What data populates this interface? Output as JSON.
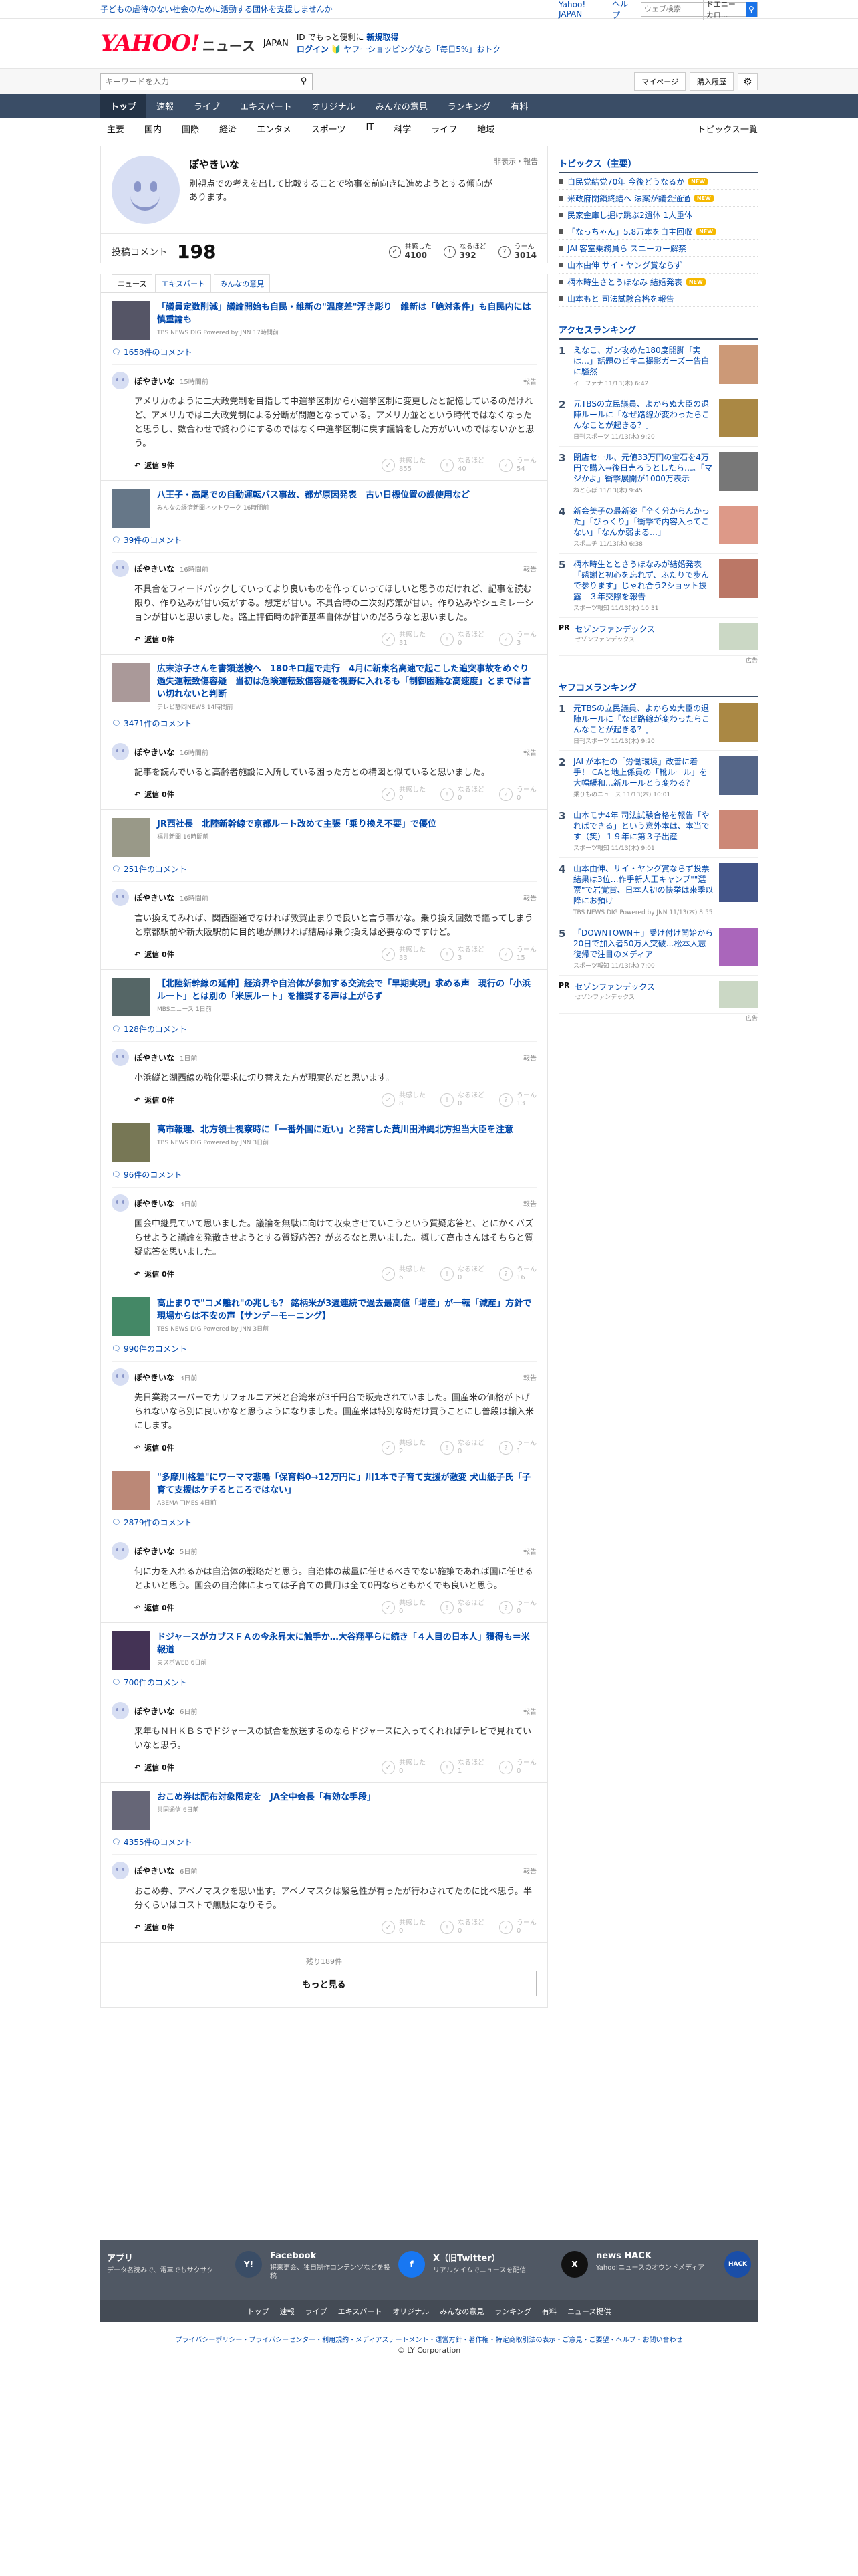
{
  "topbar": {
    "promo": "子どもの虐待のない社会のために活動する団体を支援しませんか",
    "yjapan": "Yahoo! JAPAN",
    "help": "ヘルプ",
    "search_placeholder": "ウェブ検索",
    "search_tag": "ドエニーカロ..."
  },
  "header": {
    "logo": "YAHOO!",
    "logo_sub": "JAPAN",
    "news": "ニュース",
    "promo_a": "ID でもっと便利に",
    "promo_b": "新規取得",
    "promo_login": "ログイン",
    "promo_c": "🔰 ヤフーショッピングなら「毎日5%」おトク"
  },
  "search": {
    "placeholder": "キーワードを入力",
    "mypage": "マイページ",
    "history": "購入履歴"
  },
  "nav": [
    "トップ",
    "速報",
    "ライブ",
    "エキスパート",
    "オリジナル",
    "みんなの意見",
    "ランキング",
    "有料"
  ],
  "subnav": [
    "主要",
    "国内",
    "国際",
    "経済",
    "エンタメ",
    "スポーツ",
    "IT",
    "科学",
    "ライフ",
    "地域"
  ],
  "subnav_topics": "トピックス一覧",
  "profile": {
    "name": "ぽやきいな",
    "bio": "別視点での考えを出して比較することで物事を前向きに進めようとする傾向があります。",
    "report": "非表示・報告",
    "comment_label": "投稿コメント",
    "comment_count": "198",
    "kyokan_label": "共感した",
    "kyokan": "4100",
    "naruhodo_label": "なるほど",
    "naruhodo": "392",
    "un_label": "うーん",
    "un": "3014"
  },
  "tabs": [
    "ニュース",
    "エキスパート",
    "みんなの意見"
  ],
  "entries": [
    {
      "title": "「議員定数削減」議論開始も自民・維新の\"温度差\"浮き彫り　維新は「絶対条件」も自民内には慎重論も",
      "src": "TBS NEWS DIG Powered by JNN 17時間前",
      "count": "1658件のコメント",
      "time": "15時間前",
      "text": "アメリカのように二大政党制を目指して中選挙区制から小選挙区制に変更したと記憶しているのだけれど、アメリカでは二大政党制による分断が問題となっている。アメリカ並とという時代ではなくなったと思うし、数合わせで終わりにするのではなく中選挙区制に戻す議論をした方がいいのではないかと思う。",
      "reply": "返信 9件",
      "k": "855",
      "n": "40",
      "u": "54",
      "thumb": "#556"
    },
    {
      "title": "八王子・高尾での自動運転バス事故、都が原因発表　古い日標位置の誤使用など",
      "src": "みんなの経済新聞ネットワーク 16時間前",
      "count": "39件のコメント",
      "time": "16時間前",
      "text": "不具合をフィードバックしていってより良いものを作っていってほしいと思うのだけれど、記事を読む限り、作り込みが甘い気がする。想定が甘い。不具合時の二次対応策が甘い。作り込みやシュミレーションが甘いと思いました。路上評価時の評価基準自体が甘いのだろうなと思いました。",
      "reply": "返信 0件",
      "k": "31",
      "n": "0",
      "u": "3",
      "thumb": "#678"
    },
    {
      "title": "広末涼子さんを書類送検へ　180キロ超で走行　4月に新東名高速で起こした追突事故をめぐり過失運転致傷容疑　当初は危険運転致傷容疑を視野に入れるも「制御困難な高速度」とまでは言い切れないと判断",
      "src": "テレビ静岡NEWS 14時間前",
      "count": "3471件のコメント",
      "time": "16時間前",
      "text": "記事を読んでいると高齢者施設に入所している困った方との構図と似ていると思いました。",
      "reply": "返信 0件",
      "k": "0",
      "n": "0",
      "u": "0",
      "thumb": "#a99"
    },
    {
      "title": "JR西社長　北陸新幹線で京都ルート改めて主張「乗り換え不要」で優位",
      "src": "福井新聞 16時間前",
      "count": "251件のコメント",
      "time": "16時間前",
      "text": "言い換えてみれば、関西圏通でなければ敦賀止まりで良いと言う事かな。乗り換え回数で謳ってしまうと京都駅前や新大阪駅前に目的地が無ければ結局は乗り換えは必要なのですけど。",
      "reply": "返信 0件",
      "k": "33",
      "n": "3",
      "u": "15",
      "thumb": "#998"
    },
    {
      "title": "【北陸新幹線の延伸】経済界や自治体が参加する交流会で「早期実現」求める声　現行の「小浜ルート」とは別の「米原ルート」を推奨する声は上がらず",
      "src": "MBSニュース 1日前",
      "count": "128件のコメント",
      "time": "1日前",
      "text": "小浜縦と湖西線の強化要求に切り替えた方が現実的だと思います。",
      "reply": "返信 0件",
      "k": "8",
      "n": "0",
      "u": "13",
      "thumb": "#566"
    },
    {
      "title": "高市報理、北方領土視察時に「一番外国に近い」と発言した黄川田沖縄北方担当大臣を注意",
      "src": "TBS NEWS DIG Powered by JNN 3日前",
      "count": "96件のコメント",
      "time": "3日前",
      "text": "国会中継見ていて思いました。議論を無駄に向けて収束させていこうという質疑応答と、とにかくバズらせようと議論を発散させようとする質疑応答？があるなと思いました。概して高市さんはそちらと質疑応答を思いました。",
      "reply": "返信 0件",
      "k": "6",
      "n": "0",
      "u": "16",
      "thumb": "#775"
    },
    {
      "title": "高止まりで\"コメ離れ\"の兆しも？ 銘柄米が3週連続で過去最高値「増産」が一転「減産」方針で現場からは不安の声【サンデーモーニング】",
      "src": "TBS NEWS DIG Powered by JNN 3日前",
      "count": "990件のコメント",
      "time": "3日前",
      "text": "先日業務スーパーでカリフォルニア米と台湾米が3千円台で販売されていました。国産米の価格が下げられないなら別に良いかなと思うようになりました。国産米は特別な時だけ買うことにし普段は輸入米にします。",
      "reply": "返信 0件",
      "k": "2",
      "n": "0",
      "u": "1",
      "thumb": "#486"
    },
    {
      "title": "\"多摩川格差\"にワーママ悲鳴「保育料0→12万円に」川1本で子育て支援が激変 犬山紙子氏「子育て支援はケチるところではない」",
      "src": "ABEMA TIMES 4日前",
      "count": "2879件のコメント",
      "time": "5日前",
      "text": "何に力を入れるかは自治体の戦略だと思う。自治体の裁量に任せるべきでない施策であれば国に任せるとよいと思う。国会の自治体によっては子育ての費用は全て0円ならともかくでも良いと思う。",
      "reply": "返信 0件",
      "k": "0",
      "n": "0",
      "u": "0",
      "thumb": "#b87"
    },
    {
      "title": "ドジャースがカブスＦＡの今永昇太に触手か…大谷翔平らに続き「４人目の日本人」獲得も＝米報道",
      "src": "東スポWEB 6日前",
      "count": "700件のコメント",
      "time": "6日前",
      "text": "来年もＮＨＫＢＳでドジャースの試合を放送するのならドジャースに入ってくれればテレビで見れていいなと思う。",
      "reply": "返信 0件",
      "k": "0",
      "n": "1",
      "u": "0",
      "thumb": "#435"
    },
    {
      "title": "おこめ券は配布対象限定を　JA全中会長「有効な手段」",
      "src": "共同通信 6日前",
      "count": "4355件のコメント",
      "time": "6日前",
      "text": "おこめ券、アベノマスクを思い出す。アベノマスクは緊急性が有ったが行わされてたのに比べ思う。半分くらいはコストで無駄になりそう。",
      "reply": "返信 0件",
      "k": "0",
      "n": "0",
      "u": "0",
      "thumb": "#667"
    }
  ],
  "more": {
    "remaining": "残り189件",
    "button": "もっと見る"
  },
  "right": {
    "topics_head": "トピックス（主要）",
    "topics": [
      {
        "t": "自民党結党70年 今後どうなるか",
        "b": "NEW"
      },
      {
        "t": "米政府閉鎖終結へ 法案が議会通過",
        "b": "NEW"
      },
      {
        "t": "民家金庫し掘け跳ぶ2遺体 1人重体",
        "b": ""
      },
      {
        "t": "「なっちゃん」5.8万本を自主回収",
        "b": "NEW"
      },
      {
        "t": "JAL客室乗務員ら スニーカー解禁",
        "b": ""
      },
      {
        "t": "山本由伸 サイ・ヤング賞ならず",
        "b": ""
      },
      {
        "t": "柄本時生さとうほなみ 結婚発表",
        "b": "NEW"
      },
      {
        "t": "山本もと 司法試験合格を報告",
        "b": ""
      }
    ],
    "access_head": "アクセスランキング",
    "access": [
      {
        "t": "えなこ、ガン攻めた180度開脚「実は…」話題のビキニ撮影ガーズ一告白に騒然",
        "s": "イーファナ 11/13(木) 6:42",
        "c": "#c97"
      },
      {
        "t": "元TBSの立民議員、よからぬ大臣の退陣ルールに「なぜ路線が変わったらこんなことが起きる？」",
        "s": "日刊スポーツ 11/13(木) 9:20",
        "c": "#a84"
      },
      {
        "t": "閉店セール、元値33万円の宝石を4万円で購入→後日売ろうとしたら…。「マジかよ」衝撃展開が1000万表示",
        "s": "ねとらぼ 11/13(木) 9:45",
        "c": "#777"
      },
      {
        "t": "新会美子の最新姿「全く分からんかった」「びっくり」「衝撃で内容入ってこない」「なんか弱まる…」",
        "s": "スポニチ 11/13(木) 6:38",
        "c": "#d98"
      },
      {
        "t": "柄本時生ととさうほなみが結婚発表「感謝と初心を忘れず、ふたりで歩んで参ります」じゃれ合う2ショット披露　３年交際を報告",
        "s": "スポーツ報知 11/13(木) 10:31",
        "c": "#b76"
      }
    ],
    "pr1": {
      "tag": "PR",
      "t": "セゾンファンデックス",
      "s": "セゾンファンデックス"
    },
    "yahoo_head": "ヤフコメランキング",
    "yahoo": [
      {
        "t": "元TBSの立民議員、よからぬ大臣の退陣ルールに「なぜ路線が変わったらこんなことが起きる？」",
        "s": "日刊スポーツ 11/13(木) 9:20",
        "c": "#a84"
      },
      {
        "t": "JALが本社の「労働環境」改善に着手！ CAと地上係員の「靴ルール」を大幅緩和…新ルールとう変わる？",
        "s": "乗りものニュース 11/13(木) 10:01",
        "c": "#568"
      },
      {
        "t": "山本モナ4年 司法試験合格を報告「やればできる」という意外本は、本当です（笑）１９年に第３子出産",
        "s": "スポーツ報知 11/13(木) 9:01",
        "c": "#c87"
      },
      {
        "t": "山本由伸、サイ・ヤング賞ならず投票結果は3位…作手新人王キャンプ\"\"選票\"で岩覚賞、日本人初の快挙は来季以降にお預け",
        "s": "TBS NEWS DIG Powered by JNN 11/13(木) 8:55",
        "c": "#458"
      },
      {
        "t": "「DOWNTOWN＋」受け付け開始から20日で加入者50万人突破…松本人志復帰で注目のメディア",
        "s": "スポーツ報知 11/13(木) 7:00",
        "c": "#a6b"
      }
    ],
    "pr2": {
      "tag": "PR",
      "t": "セゾンファンデックス",
      "s": "セゾンファンデックス"
    },
    "ad": "広告"
  },
  "footer": {
    "cols": [
      {
        "t": "アプリ",
        "d": "データ名読みで、電車でもサクサク",
        "i": "Y!",
        "c": "#3a4d66"
      },
      {
        "t": "Facebook",
        "d": "将来更会、独自制作コンテンツなどを投稿",
        "i": "f",
        "c": "#1877f2"
      },
      {
        "t": "X（旧Twitter）",
        "d": "リアルタイムでニュースを配信",
        "i": "X",
        "c": "#111"
      },
      {
        "t": "news HACK",
        "d": "Yahoo!ニュースのオウンドメディア",
        "i": "HACK",
        "c": "#1a4ea8"
      }
    ],
    "nav": [
      "トップ",
      "速報",
      "ライブ",
      "エキスパート",
      "オリジナル",
      "みんなの意見",
      "ランキング",
      "有料",
      "ニュース提供"
    ],
    "links": "プライバシーポリシー・プライバシーセンター・利用規約・メディアステートメント・運営方針・著作権・特定商取引法の表示・ご意見・ご要望・ヘルプ・お問い合わせ",
    "copy": "© LY Corporation"
  }
}
